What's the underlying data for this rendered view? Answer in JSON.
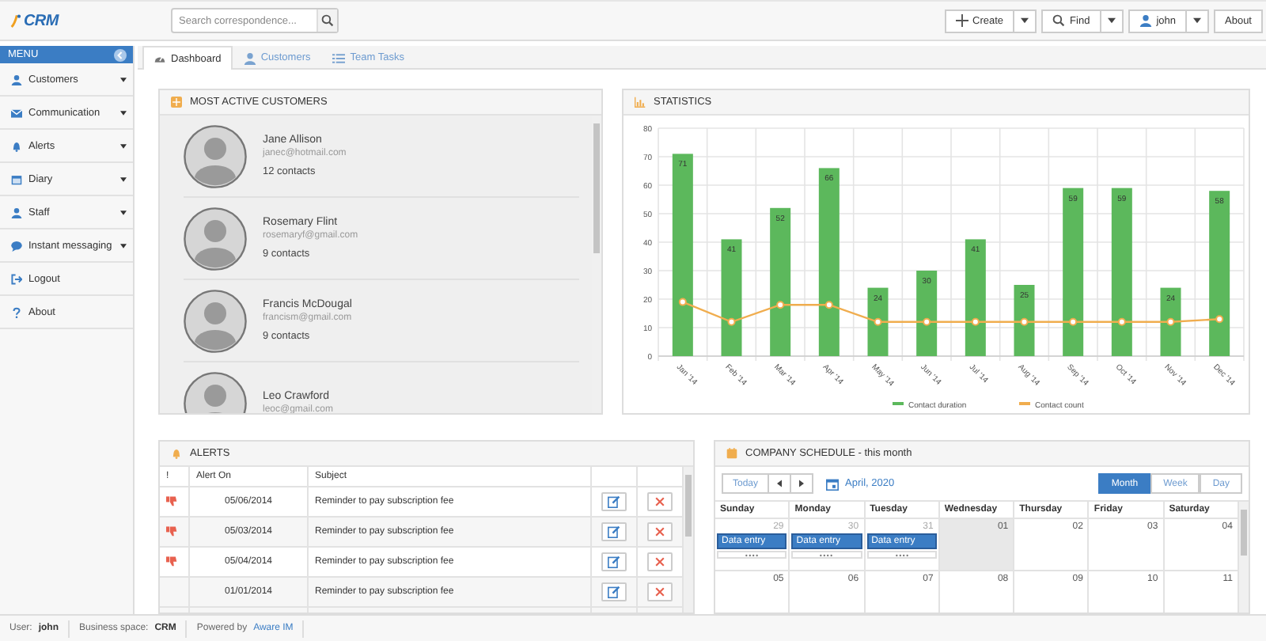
{
  "topbar": {
    "logo": "CRM",
    "search": {
      "placeholder": "Search correspondence..."
    },
    "buttons": [
      {
        "kind": "create",
        "label": "Create",
        "dropdown": true
      },
      {
        "kind": "find",
        "label": "Find",
        "dropdown": true
      },
      {
        "kind": "user",
        "label": "john",
        "dropdown": true
      },
      {
        "kind": "plain",
        "label": "About",
        "dropdown": false
      }
    ]
  },
  "sidebar": {
    "title": "MENU",
    "items": [
      {
        "kind": "user",
        "label": "Customers",
        "submenu": true
      },
      {
        "kind": "mail",
        "label": "Communication",
        "submenu": true
      },
      {
        "kind": "bell",
        "label": "Alerts",
        "submenu": true
      },
      {
        "kind": "calendar",
        "label": "Diary",
        "submenu": true
      },
      {
        "kind": "user",
        "label": "Staff",
        "submenu": true
      },
      {
        "kind": "chat",
        "label": "Instant messaging",
        "submenu": true
      },
      {
        "kind": "logout",
        "label": "Logout",
        "submenu": false
      },
      {
        "kind": "help",
        "label": "About",
        "submenu": false
      }
    ]
  },
  "tabs": [
    {
      "kind": "dashboard",
      "label": "Dashboard",
      "selected": true
    },
    {
      "kind": "user",
      "label": "Customers",
      "selected": false
    },
    {
      "kind": "list",
      "label": "Team Tasks",
      "selected": false
    }
  ],
  "customers": {
    "title": "MOST ACTIVE CUSTOMERS",
    "items": [
      {
        "name": "Jane Allison",
        "email": "janec@hotmail.com",
        "contacts": "12 contacts"
      },
      {
        "name": "Rosemary Flint",
        "email": "rosemaryf@gmail.com",
        "contacts": "9 contacts"
      },
      {
        "name": "Francis McDougal",
        "email": "francism@gmail.com",
        "contacts": "9 contacts"
      },
      {
        "name": "Leo Crawford",
        "email": "leoc@gmail.com"
      }
    ]
  },
  "statistics": {
    "title": "STATISTICS",
    "chart_data": {
      "type": "bar",
      "categories": [
        "Jan '14",
        "Feb '14",
        "Mar '14",
        "Apr '14",
        "May '14",
        "Jun '14",
        "Jul '14",
        "Aug '14",
        "Sep '14",
        "Oct '14",
        "Nov '14",
        "Dec '14"
      ],
      "series": [
        {
          "name": "Contact duration",
          "color": "#5cb85c",
          "data_labels": true,
          "values": [
            71,
            41,
            52,
            66,
            24,
            30,
            41,
            25,
            59,
            59,
            24,
            58
          ]
        },
        {
          "name": "Contact count",
          "type": "line",
          "marker": "circle",
          "color": "#f0ad4e",
          "values": [
            19,
            12,
            18,
            18,
            12,
            12,
            12,
            12,
            12,
            12,
            12,
            13
          ]
        }
      ],
      "ylim": [
        0,
        80
      ],
      "yticks": [
        0,
        10,
        20,
        30,
        40,
        50,
        60,
        70,
        80
      ],
      "grid": true,
      "legend": "bottom"
    }
  },
  "alerts": {
    "title": "ALERTS",
    "columns": [
      "!",
      "Alert On",
      "Subject"
    ],
    "rows": [
      {
        "flagged": true,
        "date": "05/06/2014",
        "subject": "Reminder to pay subscription fee"
      },
      {
        "flagged": true,
        "date": "05/03/2014",
        "subject": "Reminder to pay subscription fee"
      },
      {
        "flagged": true,
        "date": "05/04/2014",
        "subject": "Reminder to pay subscription fee"
      },
      {
        "flagged": false,
        "date": "01/01/2014",
        "subject": "Reminder to pay subscription fee"
      }
    ]
  },
  "schedule": {
    "title": "COMPANY SCHEDULE - this month",
    "today_button": "Today",
    "period": "April, 2020",
    "views": [
      {
        "label": "Month",
        "selected": true
      },
      {
        "label": "Week",
        "selected": false
      },
      {
        "label": "Day",
        "selected": false
      }
    ],
    "weekdays": [
      "Sunday",
      "Monday",
      "Tuesday",
      "Wednesday",
      "Thursday",
      "Friday",
      "Saturday"
    ],
    "weeks": [
      [
        {
          "day": "29",
          "muted": true,
          "today": false,
          "events": [
            "Data entry"
          ],
          "more": true
        },
        {
          "day": "30",
          "muted": true,
          "today": false,
          "events": [
            "Data entry"
          ],
          "more": true
        },
        {
          "day": "31",
          "muted": true,
          "today": false,
          "events": [
            "Data entry"
          ],
          "more": true
        },
        {
          "day": "01",
          "muted": false,
          "today": true,
          "more": false
        },
        {
          "day": "02",
          "muted": false,
          "today": false,
          "more": false
        },
        {
          "day": "03",
          "muted": false,
          "today": false,
          "more": false
        },
        {
          "day": "04",
          "muted": false,
          "today": false,
          "more": false
        }
      ],
      [
        {
          "day": "05",
          "muted": false,
          "today": false,
          "more": false
        },
        {
          "day": "06",
          "muted": false,
          "today": false,
          "more": false
        },
        {
          "day": "07",
          "muted": false,
          "today": false,
          "more": false
        },
        {
          "day": "08",
          "muted": false,
          "today": false,
          "more": false
        },
        {
          "day": "09",
          "muted": false,
          "today": false,
          "more": false
        },
        {
          "day": "10",
          "muted": false,
          "today": false,
          "more": false
        },
        {
          "day": "11",
          "muted": false,
          "today": false,
          "more": false
        }
      ]
    ]
  },
  "status_bar": {
    "user_label": "User:",
    "user": "john",
    "space_label": "Business space:",
    "space": "CRM",
    "powered_label": "Powered by",
    "powered_link": "Aware IM"
  }
}
